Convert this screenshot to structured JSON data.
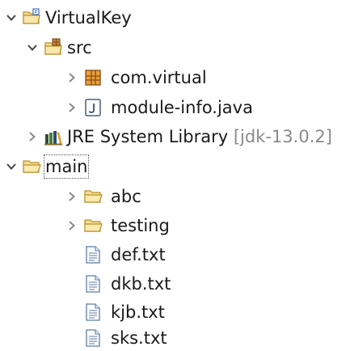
{
  "colors": {
    "folder": "#e8b84a",
    "package": "#a0522d",
    "file": "#5b7fa8",
    "jar": "#3b6e2b",
    "chevron": "#8a8a8a",
    "decoration": "#8a8a8a"
  },
  "tree": {
    "project": {
      "label": "VirtualKey",
      "icon": "project-folder-icon",
      "expanded": true
    },
    "src": {
      "label": "src",
      "icon": "source-folder-icon",
      "expanded": true
    },
    "package": {
      "label": "com.virtual",
      "icon": "package-icon",
      "expanded": false
    },
    "module_info": {
      "label": "module-info.java",
      "icon": "java-file-icon",
      "expanded": false
    },
    "jre": {
      "label": "JRE System Library",
      "decoration": "[jdk-13.0.2]",
      "icon": "library-icon",
      "expanded": false
    },
    "main": {
      "label": "main",
      "icon": "folder-icon",
      "expanded": true,
      "selected": true
    },
    "abc": {
      "label": "abc",
      "icon": "folder-icon",
      "expanded": false
    },
    "testing": {
      "label": "testing",
      "icon": "folder-icon",
      "expanded": false
    },
    "files": [
      {
        "label": "def.txt",
        "icon": "text-file-icon"
      },
      {
        "label": "dkb.txt",
        "icon": "text-file-icon"
      },
      {
        "label": "kjb.txt",
        "icon": "text-file-icon"
      },
      {
        "label": "sks.txt",
        "icon": "text-file-icon"
      }
    ]
  }
}
